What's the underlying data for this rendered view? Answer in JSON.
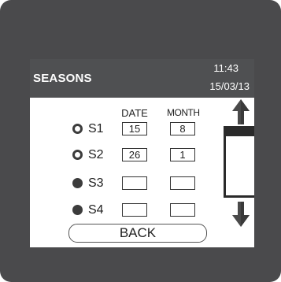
{
  "header": {
    "title": "SEASONS",
    "time": "11:43",
    "date": "15/03/13"
  },
  "columns": {
    "date": "DATE",
    "month": "MONTH"
  },
  "seasons": [
    {
      "label": "S1",
      "date": "15",
      "month": "8",
      "state": "empty-radio"
    },
    {
      "label": "S2",
      "date": "26",
      "month": "1",
      "state": "empty-radio"
    },
    {
      "label": "S3",
      "date": "",
      "month": "",
      "state": "filled-radio"
    },
    {
      "label": "S4",
      "date": "",
      "month": "",
      "state": "filled-radio"
    }
  ],
  "back_button": "BACK",
  "icons": {
    "up": "arrow-up-icon",
    "down": "arrow-down-icon"
  },
  "colors": {
    "bezel": "#4a4a4c",
    "header": "#4f5052",
    "arrow": "#4a4a4a"
  }
}
